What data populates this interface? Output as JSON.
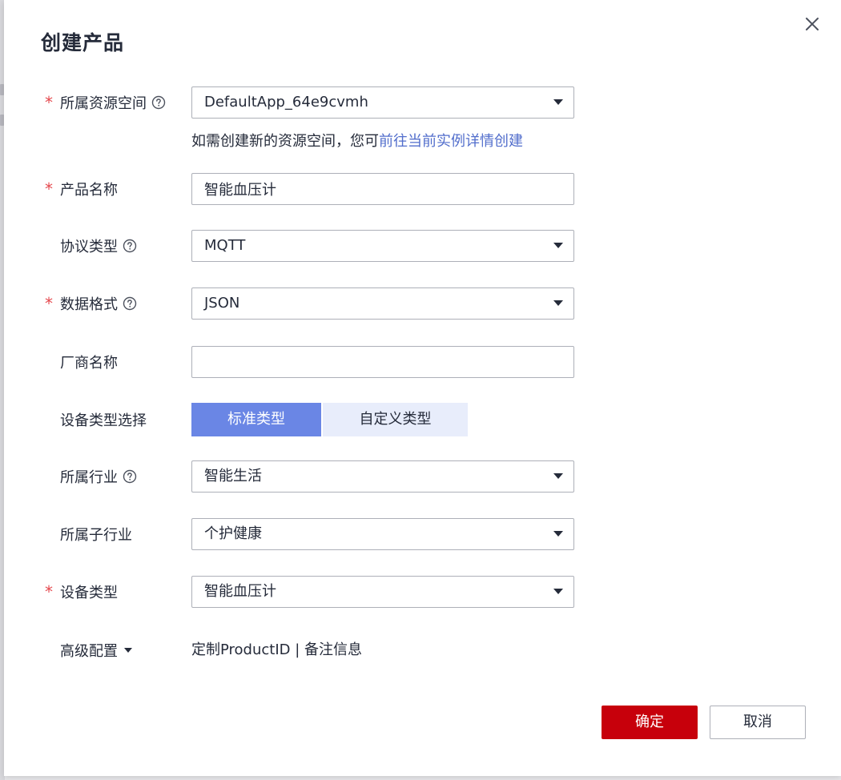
{
  "dialog": {
    "title": "创建产品"
  },
  "form": {
    "resource_space": {
      "label": "所属资源空间",
      "value": "DefaultApp_64e9cvmh",
      "hint_prefix": "如需创建新的资源空间，您可",
      "hint_link": "前往当前实例详情创建"
    },
    "product_name": {
      "label": "产品名称",
      "value": "智能血压计"
    },
    "protocol_type": {
      "label": "协议类型",
      "value": "MQTT"
    },
    "data_format": {
      "label": "数据格式",
      "value": "JSON"
    },
    "manufacturer": {
      "label": "厂商名称",
      "value": ""
    },
    "device_type_selection": {
      "label": "设备类型选择",
      "options": [
        "标准类型",
        "自定义类型"
      ],
      "selected": "标准类型"
    },
    "industry": {
      "label": "所属行业",
      "value": "智能生活"
    },
    "sub_industry": {
      "label": "所属子行业",
      "value": "个护健康"
    },
    "device_type": {
      "label": "设备类型",
      "value": "智能血压计"
    },
    "advanced": {
      "label": "高级配置",
      "summary": "定制ProductID | 备注信息"
    }
  },
  "footer": {
    "confirm_label": "确定",
    "cancel_label": "取消"
  },
  "colors": {
    "primary_red": "#c7000b",
    "link_blue": "#526ecc",
    "segment_active": "#6a86e5",
    "segment_inactive": "#e8edfb",
    "required_star": "#e5484d"
  },
  "icons": {
    "close": "close-icon",
    "help": "help-circle-icon",
    "dropdown": "caret-down-icon"
  }
}
